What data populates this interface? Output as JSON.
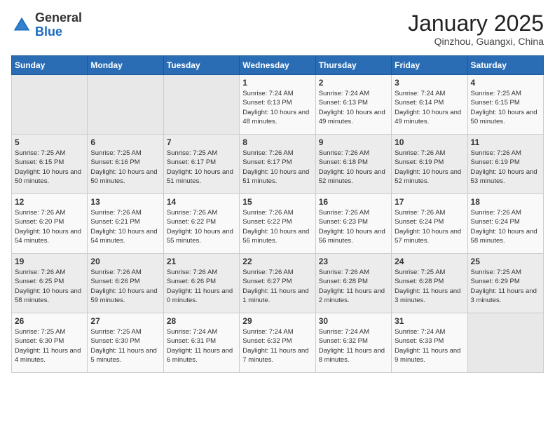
{
  "logo": {
    "general": "General",
    "blue": "Blue"
  },
  "header": {
    "month": "January 2025",
    "location": "Qinzhou, Guangxi, China"
  },
  "weekdays": [
    "Sunday",
    "Monday",
    "Tuesday",
    "Wednesday",
    "Thursday",
    "Friday",
    "Saturday"
  ],
  "weeks": [
    [
      {
        "day": "",
        "sunrise": "",
        "sunset": "",
        "daylight": ""
      },
      {
        "day": "",
        "sunrise": "",
        "sunset": "",
        "daylight": ""
      },
      {
        "day": "",
        "sunrise": "",
        "sunset": "",
        "daylight": ""
      },
      {
        "day": "1",
        "sunrise": "Sunrise: 7:24 AM",
        "sunset": "Sunset: 6:13 PM",
        "daylight": "Daylight: 10 hours and 48 minutes."
      },
      {
        "day": "2",
        "sunrise": "Sunrise: 7:24 AM",
        "sunset": "Sunset: 6:13 PM",
        "daylight": "Daylight: 10 hours and 49 minutes."
      },
      {
        "day": "3",
        "sunrise": "Sunrise: 7:24 AM",
        "sunset": "Sunset: 6:14 PM",
        "daylight": "Daylight: 10 hours and 49 minutes."
      },
      {
        "day": "4",
        "sunrise": "Sunrise: 7:25 AM",
        "sunset": "Sunset: 6:15 PM",
        "daylight": "Daylight: 10 hours and 50 minutes."
      }
    ],
    [
      {
        "day": "5",
        "sunrise": "Sunrise: 7:25 AM",
        "sunset": "Sunset: 6:15 PM",
        "daylight": "Daylight: 10 hours and 50 minutes."
      },
      {
        "day": "6",
        "sunrise": "Sunrise: 7:25 AM",
        "sunset": "Sunset: 6:16 PM",
        "daylight": "Daylight: 10 hours and 50 minutes."
      },
      {
        "day": "7",
        "sunrise": "Sunrise: 7:25 AM",
        "sunset": "Sunset: 6:17 PM",
        "daylight": "Daylight: 10 hours and 51 minutes."
      },
      {
        "day": "8",
        "sunrise": "Sunrise: 7:26 AM",
        "sunset": "Sunset: 6:17 PM",
        "daylight": "Daylight: 10 hours and 51 minutes."
      },
      {
        "day": "9",
        "sunrise": "Sunrise: 7:26 AM",
        "sunset": "Sunset: 6:18 PM",
        "daylight": "Daylight: 10 hours and 52 minutes."
      },
      {
        "day": "10",
        "sunrise": "Sunrise: 7:26 AM",
        "sunset": "Sunset: 6:19 PM",
        "daylight": "Daylight: 10 hours and 52 minutes."
      },
      {
        "day": "11",
        "sunrise": "Sunrise: 7:26 AM",
        "sunset": "Sunset: 6:19 PM",
        "daylight": "Daylight: 10 hours and 53 minutes."
      }
    ],
    [
      {
        "day": "12",
        "sunrise": "Sunrise: 7:26 AM",
        "sunset": "Sunset: 6:20 PM",
        "daylight": "Daylight: 10 hours and 54 minutes."
      },
      {
        "day": "13",
        "sunrise": "Sunrise: 7:26 AM",
        "sunset": "Sunset: 6:21 PM",
        "daylight": "Daylight: 10 hours and 54 minutes."
      },
      {
        "day": "14",
        "sunrise": "Sunrise: 7:26 AM",
        "sunset": "Sunset: 6:22 PM",
        "daylight": "Daylight: 10 hours and 55 minutes."
      },
      {
        "day": "15",
        "sunrise": "Sunrise: 7:26 AM",
        "sunset": "Sunset: 6:22 PM",
        "daylight": "Daylight: 10 hours and 56 minutes."
      },
      {
        "day": "16",
        "sunrise": "Sunrise: 7:26 AM",
        "sunset": "Sunset: 6:23 PM",
        "daylight": "Daylight: 10 hours and 56 minutes."
      },
      {
        "day": "17",
        "sunrise": "Sunrise: 7:26 AM",
        "sunset": "Sunset: 6:24 PM",
        "daylight": "Daylight: 10 hours and 57 minutes."
      },
      {
        "day": "18",
        "sunrise": "Sunrise: 7:26 AM",
        "sunset": "Sunset: 6:24 PM",
        "daylight": "Daylight: 10 hours and 58 minutes."
      }
    ],
    [
      {
        "day": "19",
        "sunrise": "Sunrise: 7:26 AM",
        "sunset": "Sunset: 6:25 PM",
        "daylight": "Daylight: 10 hours and 58 minutes."
      },
      {
        "day": "20",
        "sunrise": "Sunrise: 7:26 AM",
        "sunset": "Sunset: 6:26 PM",
        "daylight": "Daylight: 10 hours and 59 minutes."
      },
      {
        "day": "21",
        "sunrise": "Sunrise: 7:26 AM",
        "sunset": "Sunset: 6:26 PM",
        "daylight": "Daylight: 11 hours and 0 minutes."
      },
      {
        "day": "22",
        "sunrise": "Sunrise: 7:26 AM",
        "sunset": "Sunset: 6:27 PM",
        "daylight": "Daylight: 11 hours and 1 minute."
      },
      {
        "day": "23",
        "sunrise": "Sunrise: 7:26 AM",
        "sunset": "Sunset: 6:28 PM",
        "daylight": "Daylight: 11 hours and 2 minutes."
      },
      {
        "day": "24",
        "sunrise": "Sunrise: 7:25 AM",
        "sunset": "Sunset: 6:28 PM",
        "daylight": "Daylight: 11 hours and 3 minutes."
      },
      {
        "day": "25",
        "sunrise": "Sunrise: 7:25 AM",
        "sunset": "Sunset: 6:29 PM",
        "daylight": "Daylight: 11 hours and 3 minutes."
      }
    ],
    [
      {
        "day": "26",
        "sunrise": "Sunrise: 7:25 AM",
        "sunset": "Sunset: 6:30 PM",
        "daylight": "Daylight: 11 hours and 4 minutes."
      },
      {
        "day": "27",
        "sunrise": "Sunrise: 7:25 AM",
        "sunset": "Sunset: 6:30 PM",
        "daylight": "Daylight: 11 hours and 5 minutes."
      },
      {
        "day": "28",
        "sunrise": "Sunrise: 7:24 AM",
        "sunset": "Sunset: 6:31 PM",
        "daylight": "Daylight: 11 hours and 6 minutes."
      },
      {
        "day": "29",
        "sunrise": "Sunrise: 7:24 AM",
        "sunset": "Sunset: 6:32 PM",
        "daylight": "Daylight: 11 hours and 7 minutes."
      },
      {
        "day": "30",
        "sunrise": "Sunrise: 7:24 AM",
        "sunset": "Sunset: 6:32 PM",
        "daylight": "Daylight: 11 hours and 8 minutes."
      },
      {
        "day": "31",
        "sunrise": "Sunrise: 7:24 AM",
        "sunset": "Sunset: 6:33 PM",
        "daylight": "Daylight: 11 hours and 9 minutes."
      },
      {
        "day": "",
        "sunrise": "",
        "sunset": "",
        "daylight": ""
      }
    ]
  ]
}
